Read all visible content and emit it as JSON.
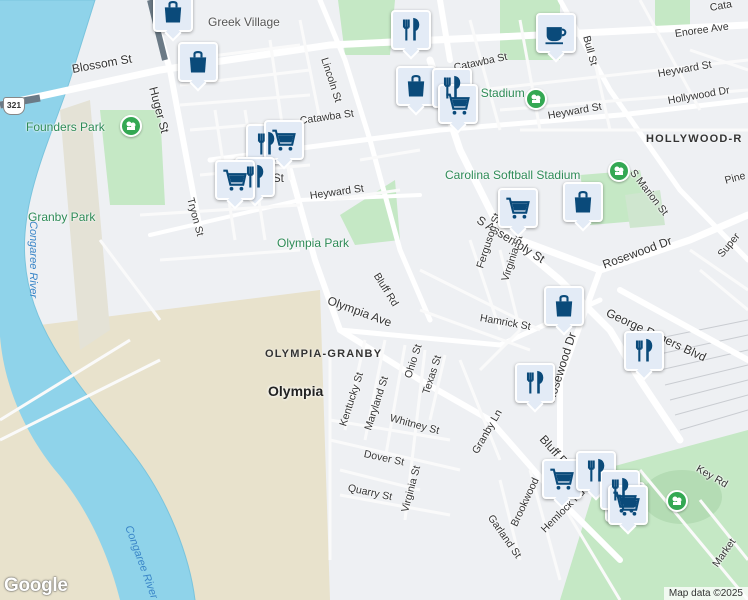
{
  "map": {
    "colors": {
      "land": "#eef0f3",
      "water": "#8fd3ea",
      "park": "#c5e8c5",
      "sand": "#e8e2cc",
      "road": "#ffffff",
      "poi_bg": "#e3ebf6",
      "poi_icon": "#0a4a7a",
      "park_icon": "#34a853"
    },
    "neighborhoods": [
      {
        "name": "OLYMPIA-GRANBY"
      },
      {
        "name": "HOLLYWOOD-R"
      }
    ],
    "places": [
      {
        "name": "Olympia"
      }
    ],
    "parks": [
      {
        "name": "Founders Park"
      },
      {
        "name": "Granby Park"
      },
      {
        "name": "Olympia Park"
      },
      {
        "name": "Greek Village"
      },
      {
        "name": "Stone Stadium"
      },
      {
        "name": "Carolina Softball Stadium"
      }
    ],
    "water": [
      {
        "name": "Congaree River"
      },
      {
        "name": "Congaree River"
      }
    ],
    "streets": [
      {
        "name": "Blossom St"
      },
      {
        "name": "Huger St"
      },
      {
        "name": "Lincoln St"
      },
      {
        "name": "Catawba St"
      },
      {
        "name": "Catawba St"
      },
      {
        "name": "Tryon St"
      },
      {
        "name": "Heyward St"
      },
      {
        "name": "Heyward St"
      },
      {
        "name": "Heyward St"
      },
      {
        "name": "S Assembly St"
      },
      {
        "name": "Bluff Rd"
      },
      {
        "name": "Olympia Ave"
      },
      {
        "name": "Ferguson St"
      },
      {
        "name": "Virginia St"
      },
      {
        "name": "Hamrick St"
      },
      {
        "name": "Rosewood Dr"
      },
      {
        "name": "Rosewood Dr"
      },
      {
        "name": "George Rogers Blvd"
      },
      {
        "name": "Ohio St"
      },
      {
        "name": "Texas St"
      },
      {
        "name": "Kentucky St"
      },
      {
        "name": "Maryland St"
      },
      {
        "name": "Whitney St"
      },
      {
        "name": "Granby Ln"
      },
      {
        "name": "Dover St"
      },
      {
        "name": "Quarry St"
      },
      {
        "name": "Virginia St"
      },
      {
        "name": "Bluff Rd"
      },
      {
        "name": "Brookwood"
      },
      {
        "name": "Garland St"
      },
      {
        "name": "Hemlock Rd"
      },
      {
        "name": "Key Rd"
      },
      {
        "name": "Market"
      },
      {
        "name": "S Marion St"
      },
      {
        "name": "Bull St"
      },
      {
        "name": "Enoree Ave"
      },
      {
        "name": "Hollywood Dr"
      },
      {
        "name": "Pine"
      },
      {
        "name": "Super"
      },
      {
        "name": "Cata"
      },
      {
        "name": "St"
      }
    ],
    "route_shield": "321",
    "logo": "Google",
    "copyright": "Map data ©2025",
    "poi_markers": [
      {
        "icon": "shopping-bag-icon"
      },
      {
        "icon": "shopping-bag-icon"
      },
      {
        "icon": "restaurant-icon"
      },
      {
        "icon": "coffee-icon"
      },
      {
        "icon": "shopping-bag-icon"
      },
      {
        "icon": "restaurant-icon"
      },
      {
        "icon": "shopping-cart-icon"
      },
      {
        "icon": "restaurant-icon"
      },
      {
        "icon": "shopping-cart-icon"
      },
      {
        "icon": "restaurant-icon"
      },
      {
        "icon": "shopping-cart-icon"
      },
      {
        "icon": "shopping-cart-icon"
      },
      {
        "icon": "shopping-bag-icon"
      },
      {
        "icon": "shopping-bag-icon"
      },
      {
        "icon": "restaurant-icon"
      },
      {
        "icon": "restaurant-icon"
      },
      {
        "icon": "shopping-cart-icon"
      },
      {
        "icon": "restaurant-icon"
      },
      {
        "icon": "shopping-cart-icon"
      },
      {
        "icon": "restaurant-icon"
      },
      {
        "icon": "shopping-cart-icon"
      }
    ]
  }
}
